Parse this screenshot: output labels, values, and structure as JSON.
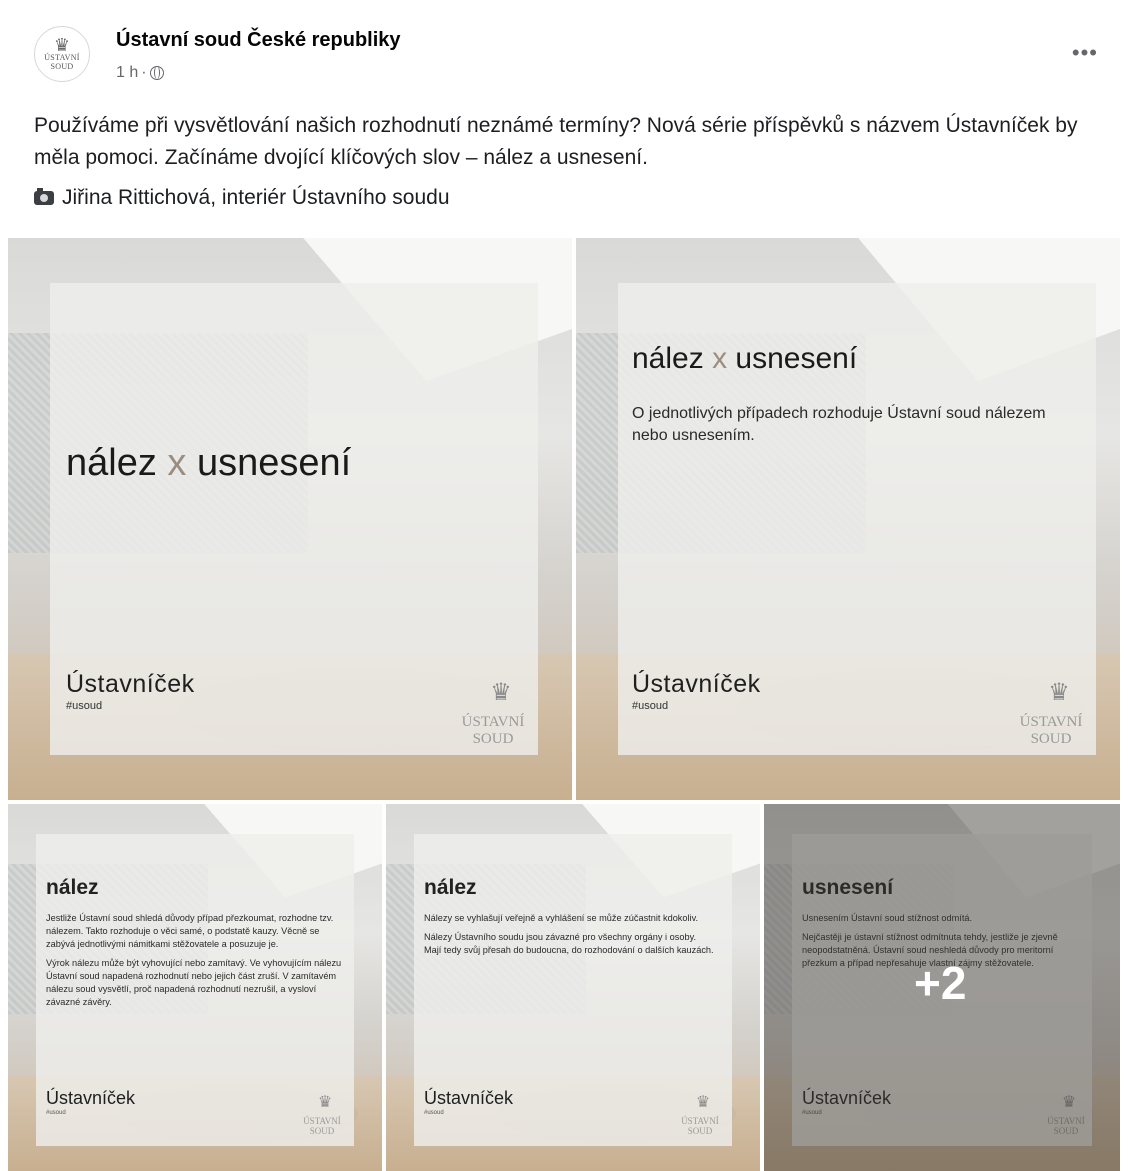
{
  "post": {
    "page_name": "Ústavní soud České republiky",
    "time": "1 h",
    "separator": "·",
    "more_label": "•••",
    "avatar_logo_line1": "ÚSTAVNÍ",
    "avatar_logo_line2": "SOUD",
    "text": "Používáme při vysvětlování našich rozhodnutí neznámé termíny? Nová série příspěvků s názvem Ústavníček by měla pomoci. Začínáme dvojící klíčových slov – nález a usnesení.",
    "photo_credit": "Jiřina Rittichová, interiér Ústavního soudu"
  },
  "images": {
    "title_left": "nález",
    "title_x": "x",
    "title_right": "usnesení",
    "brand": "Ústavníček",
    "hashtag": "#usoud",
    "logo_line1": "ÚSTAVNÍ",
    "logo_line2": "SOUD",
    "tile2_description": "O jednotlivých případech rozhoduje Ústavní soud nálezem nebo usnesením.",
    "tile3": {
      "heading": "nález",
      "p1": "Jestliže Ústavní soud shledá důvody případ přezkoumat, rozhodne tzv. nálezem. Takto rozhoduje o věci samé, o podstatě kauzy. Věcně se zabývá jednotlivými námitkami stěžovatele a posuzuje je.",
      "p2": "Výrok nálezu může být vyhovující nebo zamítavý. Ve vyhovujícím nálezu Ústavní soud napadená rozhodnutí nebo jejich část zruší. V zamítavém nálezu soud vysvětlí, proč napadená rozhodnutí nezrušil, a vysloví závazné závěry."
    },
    "tile4": {
      "heading": "nález",
      "p1": "Nálezy se vyhlašují veřejně a vyhlášení se může zúčastnit kdokoliv.",
      "p2": "Nálezy Ústavního soudu jsou závazné pro všechny orgány i osoby. Mají tedy svůj přesah do budoucna, do rozhodování o dalších kauzách."
    },
    "tile5": {
      "heading": "usnesení",
      "p1": "Usnesením Ústavní soud stížnost odmítá.",
      "p2": "Nejčastěji je ústavní stížnost odmítnuta tehdy, jestliže je zjevně neopodstatněná. Ústavní soud neshledá důvody pro meritorní přezkum a případ nepřesahuje vlastní zájmy stěžovatele.",
      "more_count": "+2"
    }
  }
}
